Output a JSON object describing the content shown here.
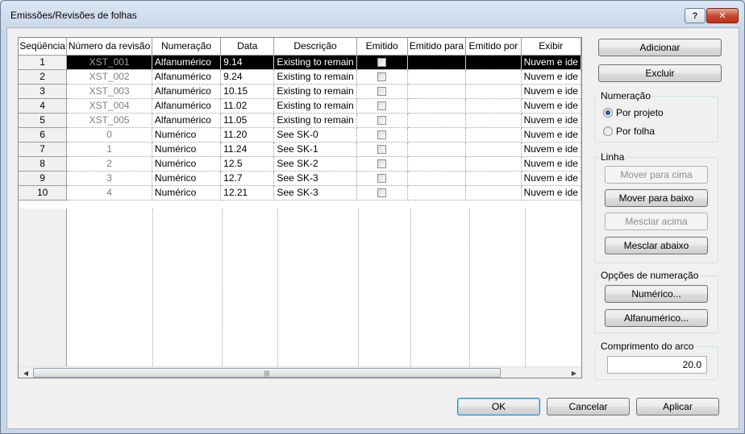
{
  "window": {
    "title": "Emissões/Revisões de folhas",
    "help_label": "?",
    "close_label": "✕"
  },
  "grid": {
    "columns": [
      "Seqüência",
      "Número da revisão",
      "Numeração",
      "Data",
      "Descrição",
      "Emitido",
      "Emitido para",
      "Emitido por",
      "Exibir"
    ],
    "rows": [
      {
        "seq": "1",
        "num": "XST_001",
        "numeracao": "Alfanumérico",
        "data": "9.14",
        "descricao": "Existing to remain",
        "para": "",
        "por": "",
        "exibir": "Nuvem e ide",
        "selected": true
      },
      {
        "seq": "2",
        "num": "XST_002",
        "numeracao": "Alfanumérico",
        "data": "9.24",
        "descricao": "Existing to remain",
        "para": "",
        "por": "",
        "exibir": "Nuvem e ide"
      },
      {
        "seq": "3",
        "num": "XST_003",
        "numeracao": "Alfanumérico",
        "data": "10.15",
        "descricao": "Existing to remain",
        "para": "",
        "por": "",
        "exibir": "Nuvem e ide"
      },
      {
        "seq": "4",
        "num": "XST_004",
        "numeracao": "Alfanumérico",
        "data": "11.02",
        "descricao": "Existing to remain",
        "para": "",
        "por": "",
        "exibir": "Nuvem e ide"
      },
      {
        "seq": "5",
        "num": "XST_005",
        "numeracao": "Alfanumérico",
        "data": "11.05",
        "descricao": "Existing to remain",
        "para": "",
        "por": "",
        "exibir": "Nuvem e ide"
      },
      {
        "seq": "6",
        "num": "0",
        "numeracao": "Numérico",
        "data": "11.20",
        "descricao": "See SK-0",
        "para": "",
        "por": "",
        "exibir": "Nuvem e ide"
      },
      {
        "seq": "7",
        "num": "1",
        "numeracao": "Numérico",
        "data": "11.24",
        "descricao": "See SK-1",
        "para": "",
        "por": "",
        "exibir": "Nuvem e ide"
      },
      {
        "seq": "8",
        "num": "2",
        "numeracao": "Numérico",
        "data": "12.5",
        "descricao": "See SK-2",
        "para": "",
        "por": "",
        "exibir": "Nuvem e ide"
      },
      {
        "seq": "9",
        "num": "3",
        "numeracao": "Numérico",
        "data": "12.7",
        "descricao": "See SK-3",
        "para": "",
        "por": "",
        "exibir": "Nuvem e ide"
      },
      {
        "seq": "10",
        "num": "4",
        "numeracao": "Numérico",
        "data": "12.21",
        "descricao": "See SK-3",
        "para": "",
        "por": "",
        "exibir": "Nuvem e ide"
      }
    ]
  },
  "buttons": {
    "adicionar": "Adicionar",
    "excluir": "Excluir",
    "mover_cima": "Mover para cima",
    "mover_baixo": "Mover para baixo",
    "mesclar_acima": "Mesclar acima",
    "mesclar_abaixo": "Mesclar abaixo",
    "numerico": "Numérico...",
    "alfanumerico": "Alfanumérico...",
    "ok": "OK",
    "cancelar": "Cancelar",
    "aplicar": "Aplicar"
  },
  "numeracao_group": {
    "title": "Numeração",
    "por_projeto": "Por projeto",
    "por_folha": "Por folha",
    "selected": "por_projeto"
  },
  "linha_group": {
    "title": "Linha"
  },
  "opcoes_group": {
    "title": "Opções de numeração"
  },
  "arco_group": {
    "title": "Comprimento do arco",
    "value": "20.0"
  }
}
